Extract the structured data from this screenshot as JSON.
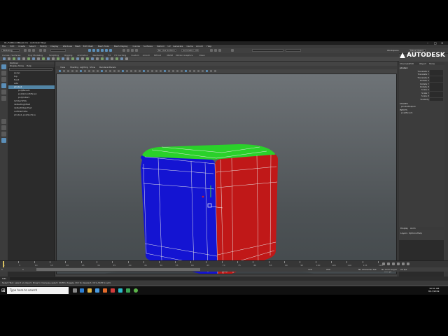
{
  "window": {
    "title": "01_FullRoundBevel.ma - Autodesk Maya",
    "controls": [
      "–",
      "□",
      "✕"
    ]
  },
  "menus": [
    "File",
    "Edit",
    "Create",
    "Select",
    "Modify",
    "Display",
    "Windows",
    "Mesh",
    "Edit Mesh",
    "Mesh Tools",
    "Mesh Display",
    "Curves",
    "Surfaces",
    "Deform",
    "UV",
    "Generate",
    "Cache",
    "Arnold",
    "Help"
  ],
  "status_line": {
    "mode": "Modeling",
    "live_surface": "No Live Surface",
    "symmetry": "Symmetry: Off",
    "workspace_label": "Workspace:",
    "workspace_value": "Maya Classic"
  },
  "logo": "AUTODESK",
  "shelf_tabs": [
    "Curves / Surfaces",
    "Poly Modeling",
    "Sculpting",
    "Rigging",
    "Animation",
    "Rendering",
    "FX",
    "FX Caching",
    "Custom",
    "Arnold",
    "Bifrost",
    "MASH",
    "Motion Graphics",
    "XGen"
  ],
  "outliner": {
    "title": "Outliner",
    "menus": [
      "Display",
      "Show",
      "Help"
    ],
    "items": [
      "persp",
      "top",
      "front",
      "side",
      "pCube1",
      "lambert2SG",
      "defaultLightSet",
      "defaultObjectSet",
      "outlinerCube",
      "pCube1_polySurface"
    ],
    "selected_index": 4,
    "children": [
      "polyBevel1",
      "polySmoothFace1",
      "polyCube1"
    ]
  },
  "viewport": {
    "menus": [
      "View",
      "Shading",
      "Lighting",
      "Show",
      "Renderer",
      "Panels"
    ],
    "camera_label": "persp",
    "fps_label": "0.0 fps",
    "colors": {
      "top": "#22cc22",
      "front": "#1111cc",
      "right": "#bb1111",
      "wire": "#e8e8e8"
    }
  },
  "channel_box": {
    "tabs": [
      "Channels",
      "Edit",
      "Object",
      "Show"
    ],
    "object": "pCube1",
    "attributes": [
      "Translate X",
      "Translate Y",
      "Translate Z",
      "Rotate X",
      "Rotate Y",
      "Rotate Z",
      "Scale X",
      "Scale Y",
      "Scale Z",
      "Visibility"
    ],
    "shapes_label": "SHAPES",
    "shape": "pCubeShape1",
    "inputs_label": "INPUTS",
    "input": "polyBevel1"
  },
  "layers": {
    "tabs": [
      "Display",
      "Anim"
    ],
    "menus": [
      "Layers",
      "Options",
      "Help"
    ]
  },
  "time": {
    "ticks": [
      "1",
      "5",
      "10",
      "15",
      "20",
      "25",
      "30",
      "35",
      "40",
      "45",
      "50",
      "55",
      "60",
      "65",
      "70",
      "75",
      "80",
      "85",
      "90",
      "95",
      "100",
      "105",
      "110",
      "115",
      "120"
    ],
    "start": "1",
    "end": "120",
    "range_end": "200",
    "current": "1",
    "no_character_set": "No Character Set",
    "no_anim_layer": "No Anim Layer",
    "fps_setting": "24 fps"
  },
  "command_line": {
    "lang": "MEL"
  },
  "help_line": "Select Tool: select an object. Drag to marquee-select. Shift to toggle, Ctrl to deselect, Ctrl+Shift to add.",
  "taskbar": {
    "search_placeholder": "Type here to search",
    "time": "10:51 AM",
    "date": "8/17/2019"
  }
}
